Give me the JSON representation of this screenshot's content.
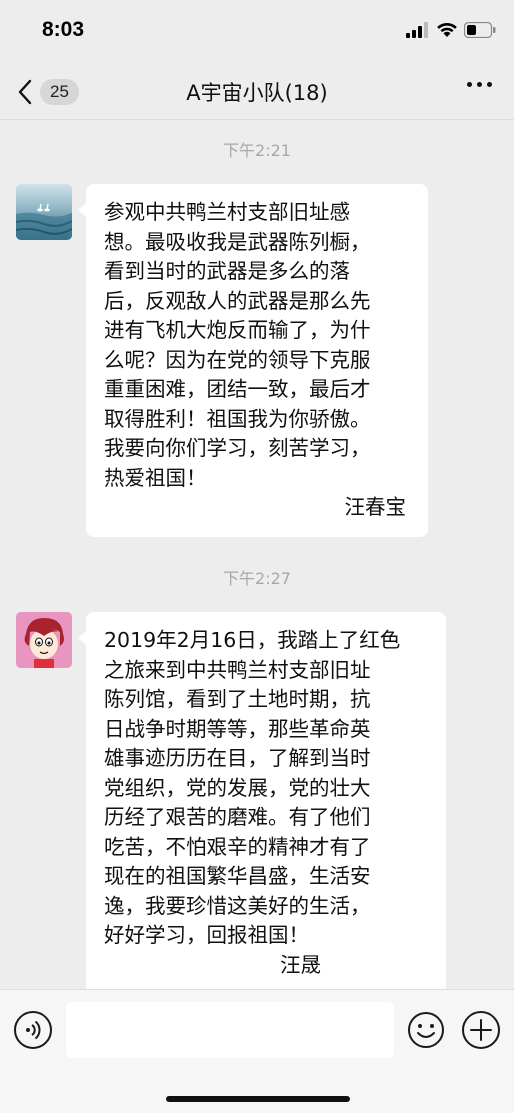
{
  "status_bar": {
    "time": "8:03",
    "icons": [
      "signal-icon",
      "wifi-icon",
      "battery-icon"
    ]
  },
  "nav": {
    "back_count": "25",
    "title": "A宇宙小队(18)",
    "more_icon": "more-icon"
  },
  "messages": [
    {
      "timestamp": "下午2:21",
      "text": "参观中共鸭兰村支部旧址感\n想。最吸收我是武器陈列橱，\n看到当时的武器是多么的落\n后，反观敌人的武器是那么先\n进有飞机大炮反而输了，为什\n么呢？因为在党的领导下克服\n重重困难，团结一致，最后才\n取得胜利！祖国我为你骄傲。\n我要向你们学习，刻苦学习，\n热爱祖国！",
      "signature": "汪春宝",
      "avatar": "lake-photo-avatar"
    },
    {
      "timestamp": "下午2:27",
      "text": "2019年2月16日，我踏上了红色\n之旅来到中共鸭兰村支部旧址\n陈列馆，看到了土地时期，抗\n日战争时期等等，那些革命英\n雄事迹历历在目，了解到当时\n党组织，党的发展，党的壮大\n历经了艰苦的磨难。有了他们\n吃苦，不怕艰辛的精神才有了\n现在的祖国繁华昌盛，生活安\n逸，我要珍惜这美好的生活，\n好好学习，回报祖国！",
      "signature": "汪晟",
      "avatar": "cartoon-girl-avatar"
    }
  ],
  "input_bar": {
    "voice_icon": "voice-icon",
    "input_value": "",
    "emoji_icon": "emoji-icon",
    "plus_icon": "plus-icon"
  },
  "colors": {
    "background": "#ededed",
    "bubble": "#ffffff",
    "timestamp": "#a8a8a8"
  }
}
